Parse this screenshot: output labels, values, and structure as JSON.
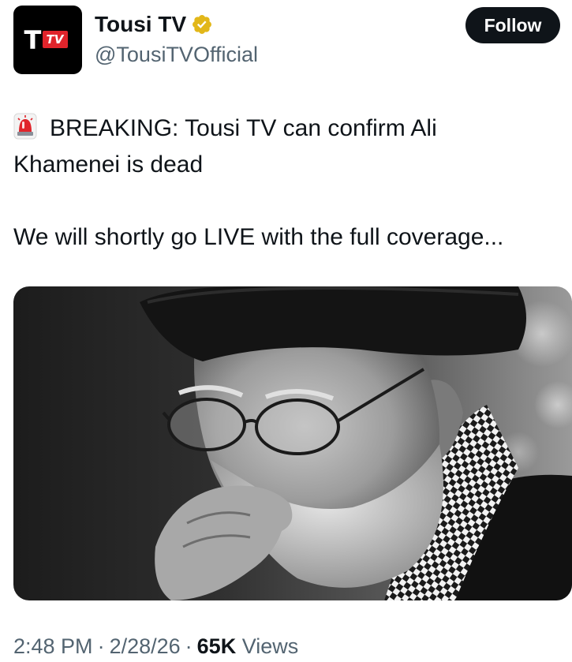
{
  "author": {
    "avatar_logo_t": "T",
    "avatar_logo_tv": "TV",
    "display_name": "Tousi TV",
    "handle": "@TousiTVOfficial",
    "verified_badge": "gold-verified-icon"
  },
  "actions": {
    "follow_label": "Follow"
  },
  "tweet": {
    "line1": "BREAKING: Tousi TV can confirm Ali",
    "line2": "Khamenei is dead",
    "line3": "We will shortly go LIVE with the full coverage...",
    "leading_icon": "police-siren-icon"
  },
  "media": {
    "type": "photo",
    "palette": "black-and-white"
  },
  "meta": {
    "time": "2:48 PM",
    "date": "2/28/26",
    "views_count": "65K",
    "views_label": "Views",
    "separator": "·"
  },
  "colors": {
    "text_primary": "#0f1419",
    "text_secondary": "#536471",
    "follow_bg": "#0f1419",
    "brand_red": "#e0242b",
    "verified_gold": "#e2b719"
  }
}
